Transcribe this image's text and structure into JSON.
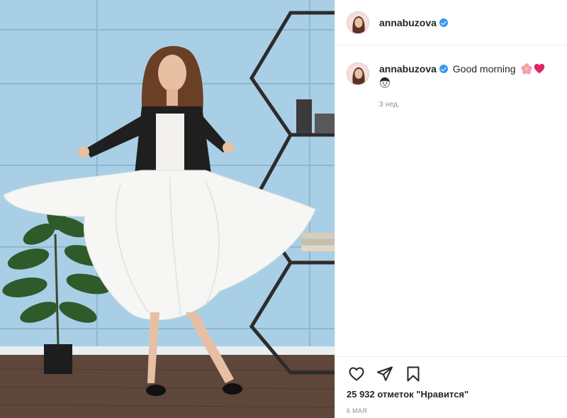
{
  "header": {
    "username": "annabuzova",
    "verified": true
  },
  "comment": {
    "username": "annabuzova",
    "text": "Good morning",
    "emojis": [
      "flower-emoji",
      "heart-emoji",
      "face-emoji"
    ],
    "time": "3 нед."
  },
  "actions": {
    "icons": [
      "heart-outline-icon",
      "share-plane-icon",
      "bookmark-icon"
    ]
  },
  "likes_text": "25 932 отметок \"Нравится\"",
  "date": "6 мая",
  "colors": {
    "wall": "#a9cfe6",
    "floor": "#5e463a",
    "verified": "#3897f0",
    "heart": "#e0245e",
    "muted": "#8e8e8e"
  }
}
